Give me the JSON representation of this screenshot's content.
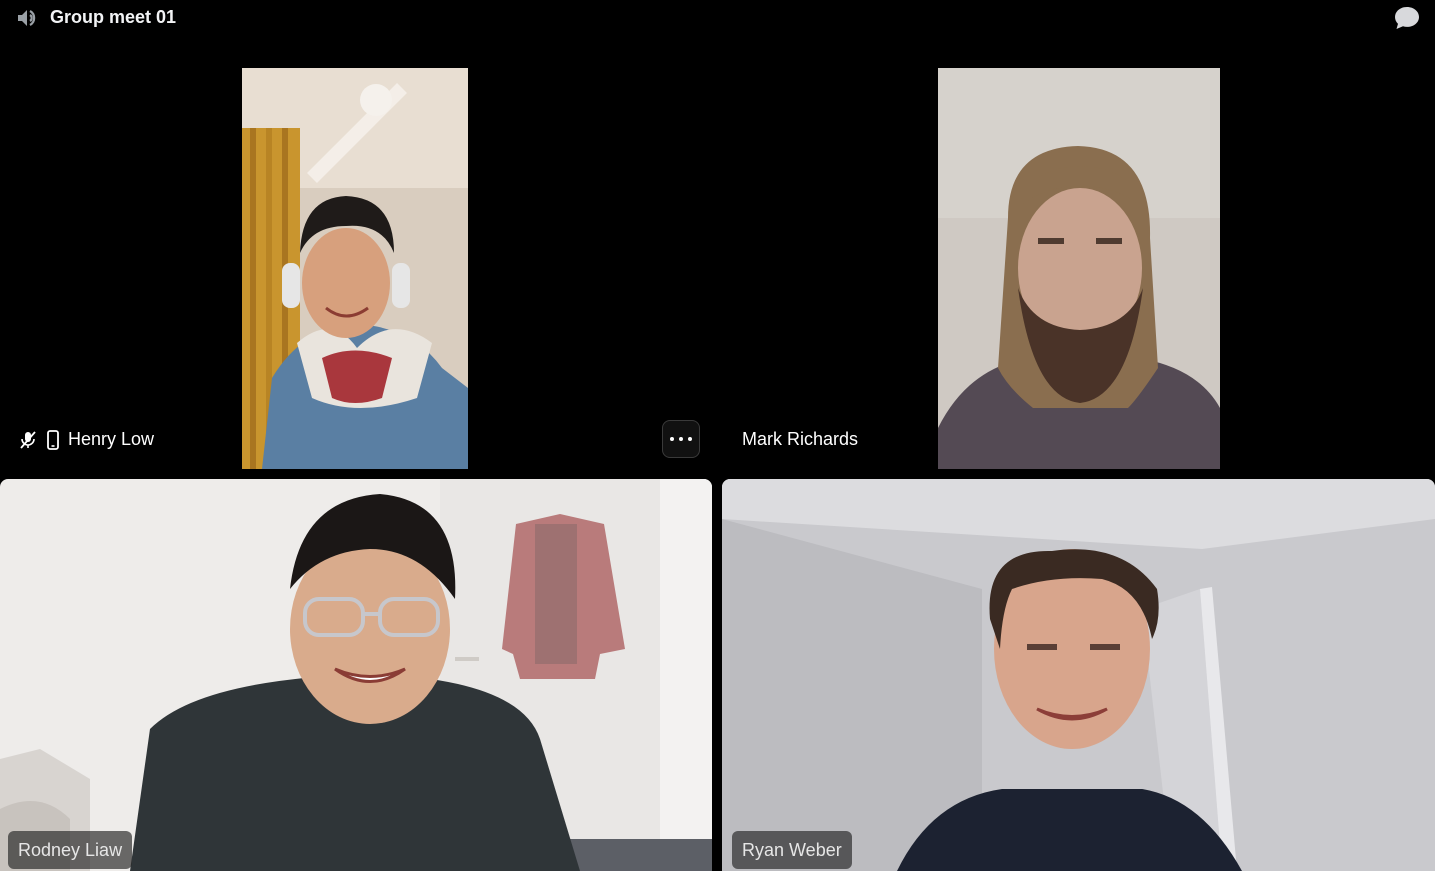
{
  "header": {
    "title": "Group meet 01",
    "channel_icon": "voice-channel-icon",
    "chat_icon": "chat-bubble-icon"
  },
  "participants": [
    {
      "name": "Henry Low",
      "muted_icon": "mic-muted-icon",
      "device_icon": "mobile-phone-icon",
      "more_icon": "more-options-icon"
    },
    {
      "name": "Mark Richards"
    },
    {
      "name": "Rodney Liaw"
    },
    {
      "name": "Ryan Weber"
    }
  ],
  "colors": {
    "background": "#000000",
    "name_pill": "#2a2a2a",
    "text": "#ffffff"
  }
}
